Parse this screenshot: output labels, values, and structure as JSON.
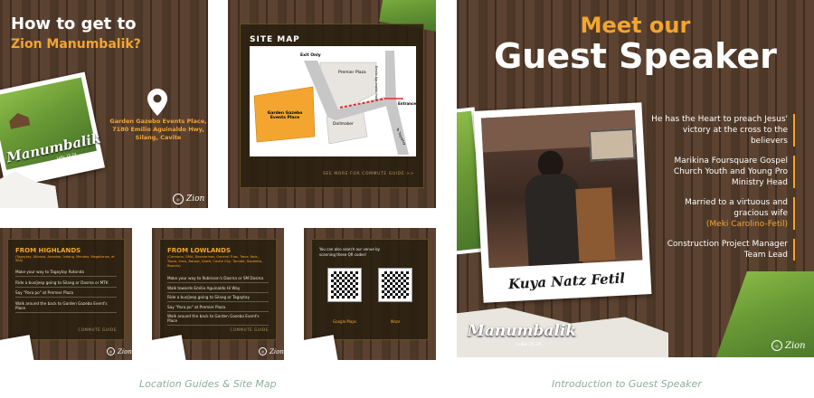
{
  "card1": {
    "title_line1": "How to get to",
    "title_line2": "Zion Manumbalik?",
    "address": "Garden Gazebo Events Place,\n7180 Emilio Aguinaldo Hwy,\nSilang, Cavite",
    "polaroid_script": "Manumbalik",
    "polaroid_verse": "Luke 15:24",
    "logo_text": "Zion"
  },
  "card2": {
    "heading": "SITE MAP",
    "labels": {
      "exit": "Exit Only",
      "premier": "Premier Plaza",
      "garden": "Garden Gazebo\nEvents Place",
      "dollmaker": "Dollmaker",
      "entrance": "Entrance",
      "tagaytay": "To Tagaytay",
      "emilio": "Emilio Aguinaldo Hwy"
    },
    "footer": "SEE MORE FOR COMMUTE GUIDE >>"
  },
  "card3": {
    "heading": "FROM HIGHLANDS",
    "subheading": "(Tagaytay, Alfonso, Amadeo, Indang, Mendez, Magallanes, et SEA)",
    "steps": [
      "Make your way to Tagaytay Rotonda",
      "Ride a bus/jeep going to Silang or Dasma or MTK",
      "Say \"Para po\" at Premier Plaza",
      "Walk around the back to Garden Gazebo Event's Place"
    ],
    "footer": "COMMUTE GUIDE",
    "logo_text": "Zion"
  },
  "card4": {
    "heading": "FROM LOWLANDS",
    "subheading": "(Carmona, GMA, Dasmarinas, General Trias, Trece, Naic, Tanza, Imus, Bacoor, Kawit, Cavite City, Tarnate, Noveleta, Rosario)",
    "steps": [
      "Make your way to Robinson's Dasma or SM Dasma",
      "Walk towards Emilio Aguinaldo Hi Way",
      "Ride a bus/jeep going to Silang or Tagaytay",
      "Say \"Para po\" at Premier Plaza",
      "Walk around the back to Garden Gazebo Event's Place"
    ],
    "footer": "COMMUTE GUIDE",
    "logo_text": "Zion"
  },
  "card5": {
    "intro": "You can also search our venue by scanning these QR codes!",
    "qr1_label": "Google Maps",
    "qr2_label": "Waze"
  },
  "speaker": {
    "title_small": "Meet our",
    "title_big": "Guest Speaker",
    "name": "Kuya Natz Fetil",
    "facts": [
      {
        "text": "He has the Heart to preach Jesus' victory at the cross to the believers",
        "highlight": ""
      },
      {
        "text": "Marikina Foursquare Gospel Church Youth and Young Pro Ministry Head",
        "highlight": ""
      },
      {
        "text": "Married to a virtuous and gracious wife",
        "highlight": "(Meki Carolino-Fetil)"
      },
      {
        "text": "Construction Project Manager Team Lead",
        "highlight": ""
      }
    ],
    "brand_script": "Manumbalik",
    "brand_verse": "Luke 15:24",
    "logo_text": "Zion"
  },
  "captions": {
    "left": "Location Guides & Site Map",
    "right": "Introduction to Guest Speaker"
  },
  "colors": {
    "accent": "#f3a530",
    "panel": "#2e2416",
    "caption": "#8fae9a"
  }
}
